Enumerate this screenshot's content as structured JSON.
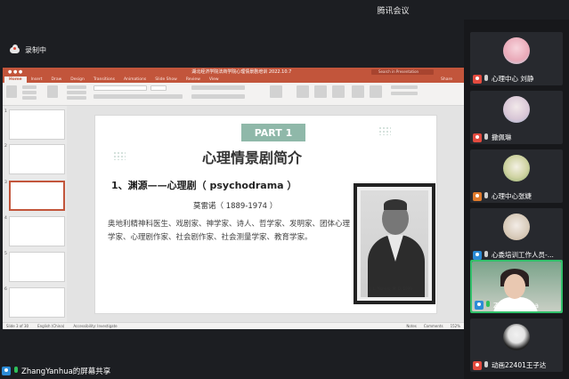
{
  "app": {
    "title": "腾讯会议",
    "recording_label": "录制中",
    "share_label": "ZhangYanhua的屏幕共享"
  },
  "ppt": {
    "file_title": "湖北经济学院法商学院心理情景剧培训 2022.10.7",
    "search_placeholder": "Search in Presentation",
    "tabs": [
      "Home",
      "Insert",
      "Draw",
      "Design",
      "Transitions",
      "Animations",
      "Slide Show",
      "Review",
      "View"
    ],
    "share_label": "Share",
    "slide": {
      "part": "PART 1",
      "title": "心理情景剧简介",
      "subtitle": "1、渊源——心理剧（ psychodrama ）",
      "person": "莫雷诺（ 1889-1974 ）",
      "body": "奥地利精神科医生、戏剧家、神学家、诗人、哲学家、发明家、团体心理学家、心理剧作家、社会剧作家、社会测量学家、教育学家。",
      "photo_caption": "J. L. Moreno, M. D. 1939"
    },
    "thumbnails": [
      "1",
      "2",
      "3",
      "4",
      "5",
      "6"
    ],
    "selected_thumbnail": "3",
    "status": {
      "slide": "Slide 3 of 30",
      "language": "English (China)",
      "accessibility": "Accessibility: Investigate",
      "notes": "Notes",
      "comments": "Comments",
      "zoom": "152%"
    }
  },
  "participants": [
    {
      "name": "心理中心 刘静",
      "audio": "speaker-muted"
    },
    {
      "name": "撒佩琳",
      "audio": "speaker-muted"
    },
    {
      "name": "心理中心张婕",
      "audio": "speaker-muted"
    },
    {
      "name": "心委培训工作人员-...",
      "audio": "speaker-muted"
    },
    {
      "name": "ZhangYanhua",
      "audio": "mic-on"
    },
    {
      "name": "动画22401王子达",
      "audio": "speaker-muted"
    }
  ]
}
